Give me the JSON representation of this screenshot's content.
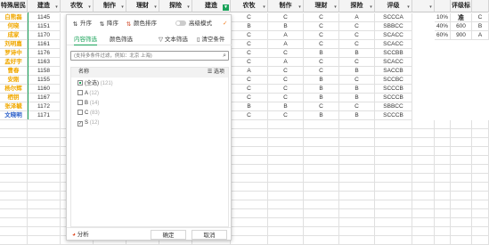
{
  "columns_left": [
    "特殊居民",
    "建造",
    "农牧",
    "制作",
    "理财",
    "探险",
    "建造"
  ],
  "columns_right": [
    "农牧",
    "制作",
    "理财",
    "探险",
    "评级",
    "",
    "",
    "评级标准",
    ""
  ],
  "names": [
    "白熊磊",
    "何晓",
    "成家",
    "刘明嘉",
    "罗诗中",
    "孟好宇",
    "曹春",
    "安刚",
    "杨尔辉",
    "栖钥",
    "张泽毓",
    "文晓明"
  ],
  "ids": [
    "1145",
    "1151",
    "1170",
    "1161",
    "1176",
    "1163",
    "1158",
    "1155",
    "1160",
    "1167",
    "1172",
    "1171"
  ],
  "right_rows": [
    [
      "C",
      "C",
      "C",
      "A",
      "SCCCA"
    ],
    [
      "B",
      "B",
      "C",
      "C",
      "SBBCC"
    ],
    [
      "C",
      "A",
      "C",
      "C",
      "SCACC"
    ],
    [
      "C",
      "A",
      "C",
      "C",
      "SCACC"
    ],
    [
      "C",
      "C",
      "B",
      "B",
      "SCCBB"
    ],
    [
      "C",
      "A",
      "C",
      "C",
      "SCACC"
    ],
    [
      "A",
      "C",
      "C",
      "B",
      "SACCB"
    ],
    [
      "C",
      "C",
      "B",
      "C",
      "SCCBC"
    ],
    [
      "C",
      "C",
      "B",
      "B",
      "SCCCB"
    ],
    [
      "C",
      "C",
      "B",
      "B",
      "SCCCB"
    ],
    [
      "B",
      "B",
      "C",
      "C",
      "SBBCC"
    ],
    [
      "C",
      "C",
      "B",
      "B",
      "SCCCB"
    ]
  ],
  "criteria_rows": [
    [
      "10%",
      "0",
      "C"
    ],
    [
      "40%",
      "600",
      "B"
    ],
    [
      "60%",
      "900",
      "A"
    ]
  ],
  "panel": {
    "sort_asc": "升序",
    "sort_desc": "降序",
    "sort_color": "颜色排序",
    "advanced": "高级模式",
    "tab_content": "内容筛选",
    "tab_color": "颜色筛选",
    "text_filter": "文本筛选",
    "clear": "清空条件",
    "search_placeholder": "(支持多条件过滤，例如：北京 上海)",
    "list_header": "名称",
    "list_options": "选项",
    "items": [
      {
        "label": "(全选)",
        "count": "(121)"
      },
      {
        "label": "A",
        "count": "(12)"
      },
      {
        "label": "B",
        "count": "(14)"
      },
      {
        "label": "C",
        "count": "(83)"
      },
      {
        "label": "S",
        "count": "(12)"
      }
    ],
    "analysis": "分析",
    "ok": "确定",
    "cancel": "取消"
  },
  "colors": {
    "accent": "#1aa35a",
    "name_highlight": "#f0a800",
    "name_blue": "#2b5fc9"
  }
}
